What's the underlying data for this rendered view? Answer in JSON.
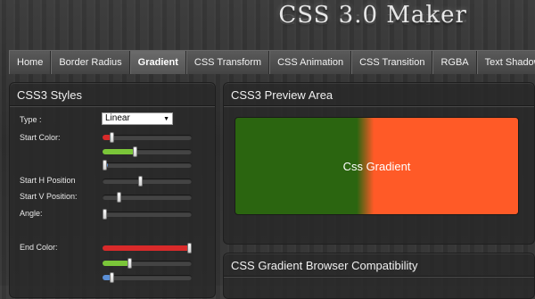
{
  "app": {
    "title": "CSS 3.0 Maker"
  },
  "tabs": [
    {
      "label": "Home",
      "active": false
    },
    {
      "label": "Border Radius",
      "active": false
    },
    {
      "label": "Gradient",
      "active": true
    },
    {
      "label": "CSS Transform",
      "active": false
    },
    {
      "label": "CSS Animation",
      "active": false
    },
    {
      "label": "CSS Transition",
      "active": false
    },
    {
      "label": "RGBA",
      "active": false
    },
    {
      "label": "Text Shadow",
      "active": false
    }
  ],
  "styles_panel": {
    "title": "CSS3 Styles",
    "type_label": "Type :",
    "type_value": "Linear",
    "start_color_label": "Start Color:",
    "start_h_label": "Start H Position",
    "start_v_label": "Start V Position:",
    "angle_label": "Angle:",
    "end_color_label": "End Color:",
    "start_color": {
      "r": 0.1,
      "g": 0.36,
      "b": 0.0,
      "hex": "#2b6510"
    },
    "start_h_position": 0.42,
    "start_v_position": 0.18,
    "angle": 0.0,
    "end_color": {
      "r": 1.0,
      "g": 0.3,
      "b": 0.1,
      "hex": "#ff5a27"
    },
    "colors": {
      "red_track": "#d92a2a",
      "green_track": "#7bc639",
      "blue_track": "#5b8fd6"
    }
  },
  "preview_panel": {
    "title": "CSS3 Preview Area",
    "preview_text": "Css Gradient"
  },
  "compat_panel": {
    "title": "CSS Gradient Browser Compatibility"
  }
}
